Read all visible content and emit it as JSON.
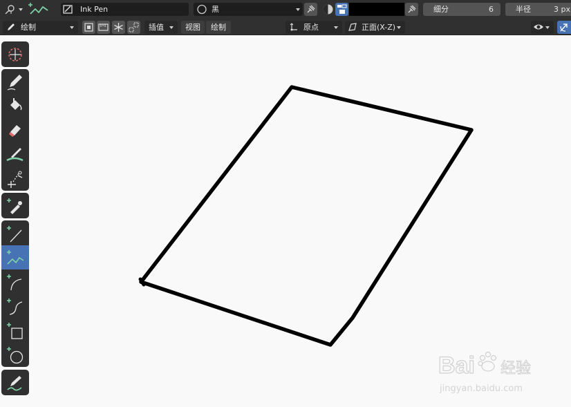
{
  "top_bar": {
    "brush_name": "Ink Pen",
    "material_name": "黑",
    "color_hex": "#000000",
    "subdivision": {
      "label": "细分",
      "value": "6"
    },
    "radius": {
      "label": "半径",
      "value": "3 px"
    }
  },
  "second_bar": {
    "mode": "绘制",
    "interpolation": "插值",
    "view_label": "视图",
    "draw_label": "绘制",
    "origin": "原点",
    "orientation": "正面(X-Z)"
  },
  "accent_color": "#4772b3",
  "toolbar": {
    "groups": [
      {
        "tools": [
          "cursor-icon"
        ]
      },
      {
        "tools": [
          "draw-icon",
          "fill-icon",
          "erase-icon",
          "tint-icon",
          "cutter-icon"
        ]
      },
      {
        "tools": [
          "eyedropper-icon"
        ]
      },
      {
        "tools": [
          "line-icon",
          "polyline-icon",
          "arc-icon",
          "curve-icon",
          "box-icon",
          "circle-icon"
        ],
        "active": "polyline-icon"
      },
      {
        "tools": [
          "annotate-icon"
        ]
      }
    ]
  },
  "watermark": {
    "brand": "Bai",
    "brand_cn": "经验",
    "url": "jingyan.baidu.com"
  }
}
